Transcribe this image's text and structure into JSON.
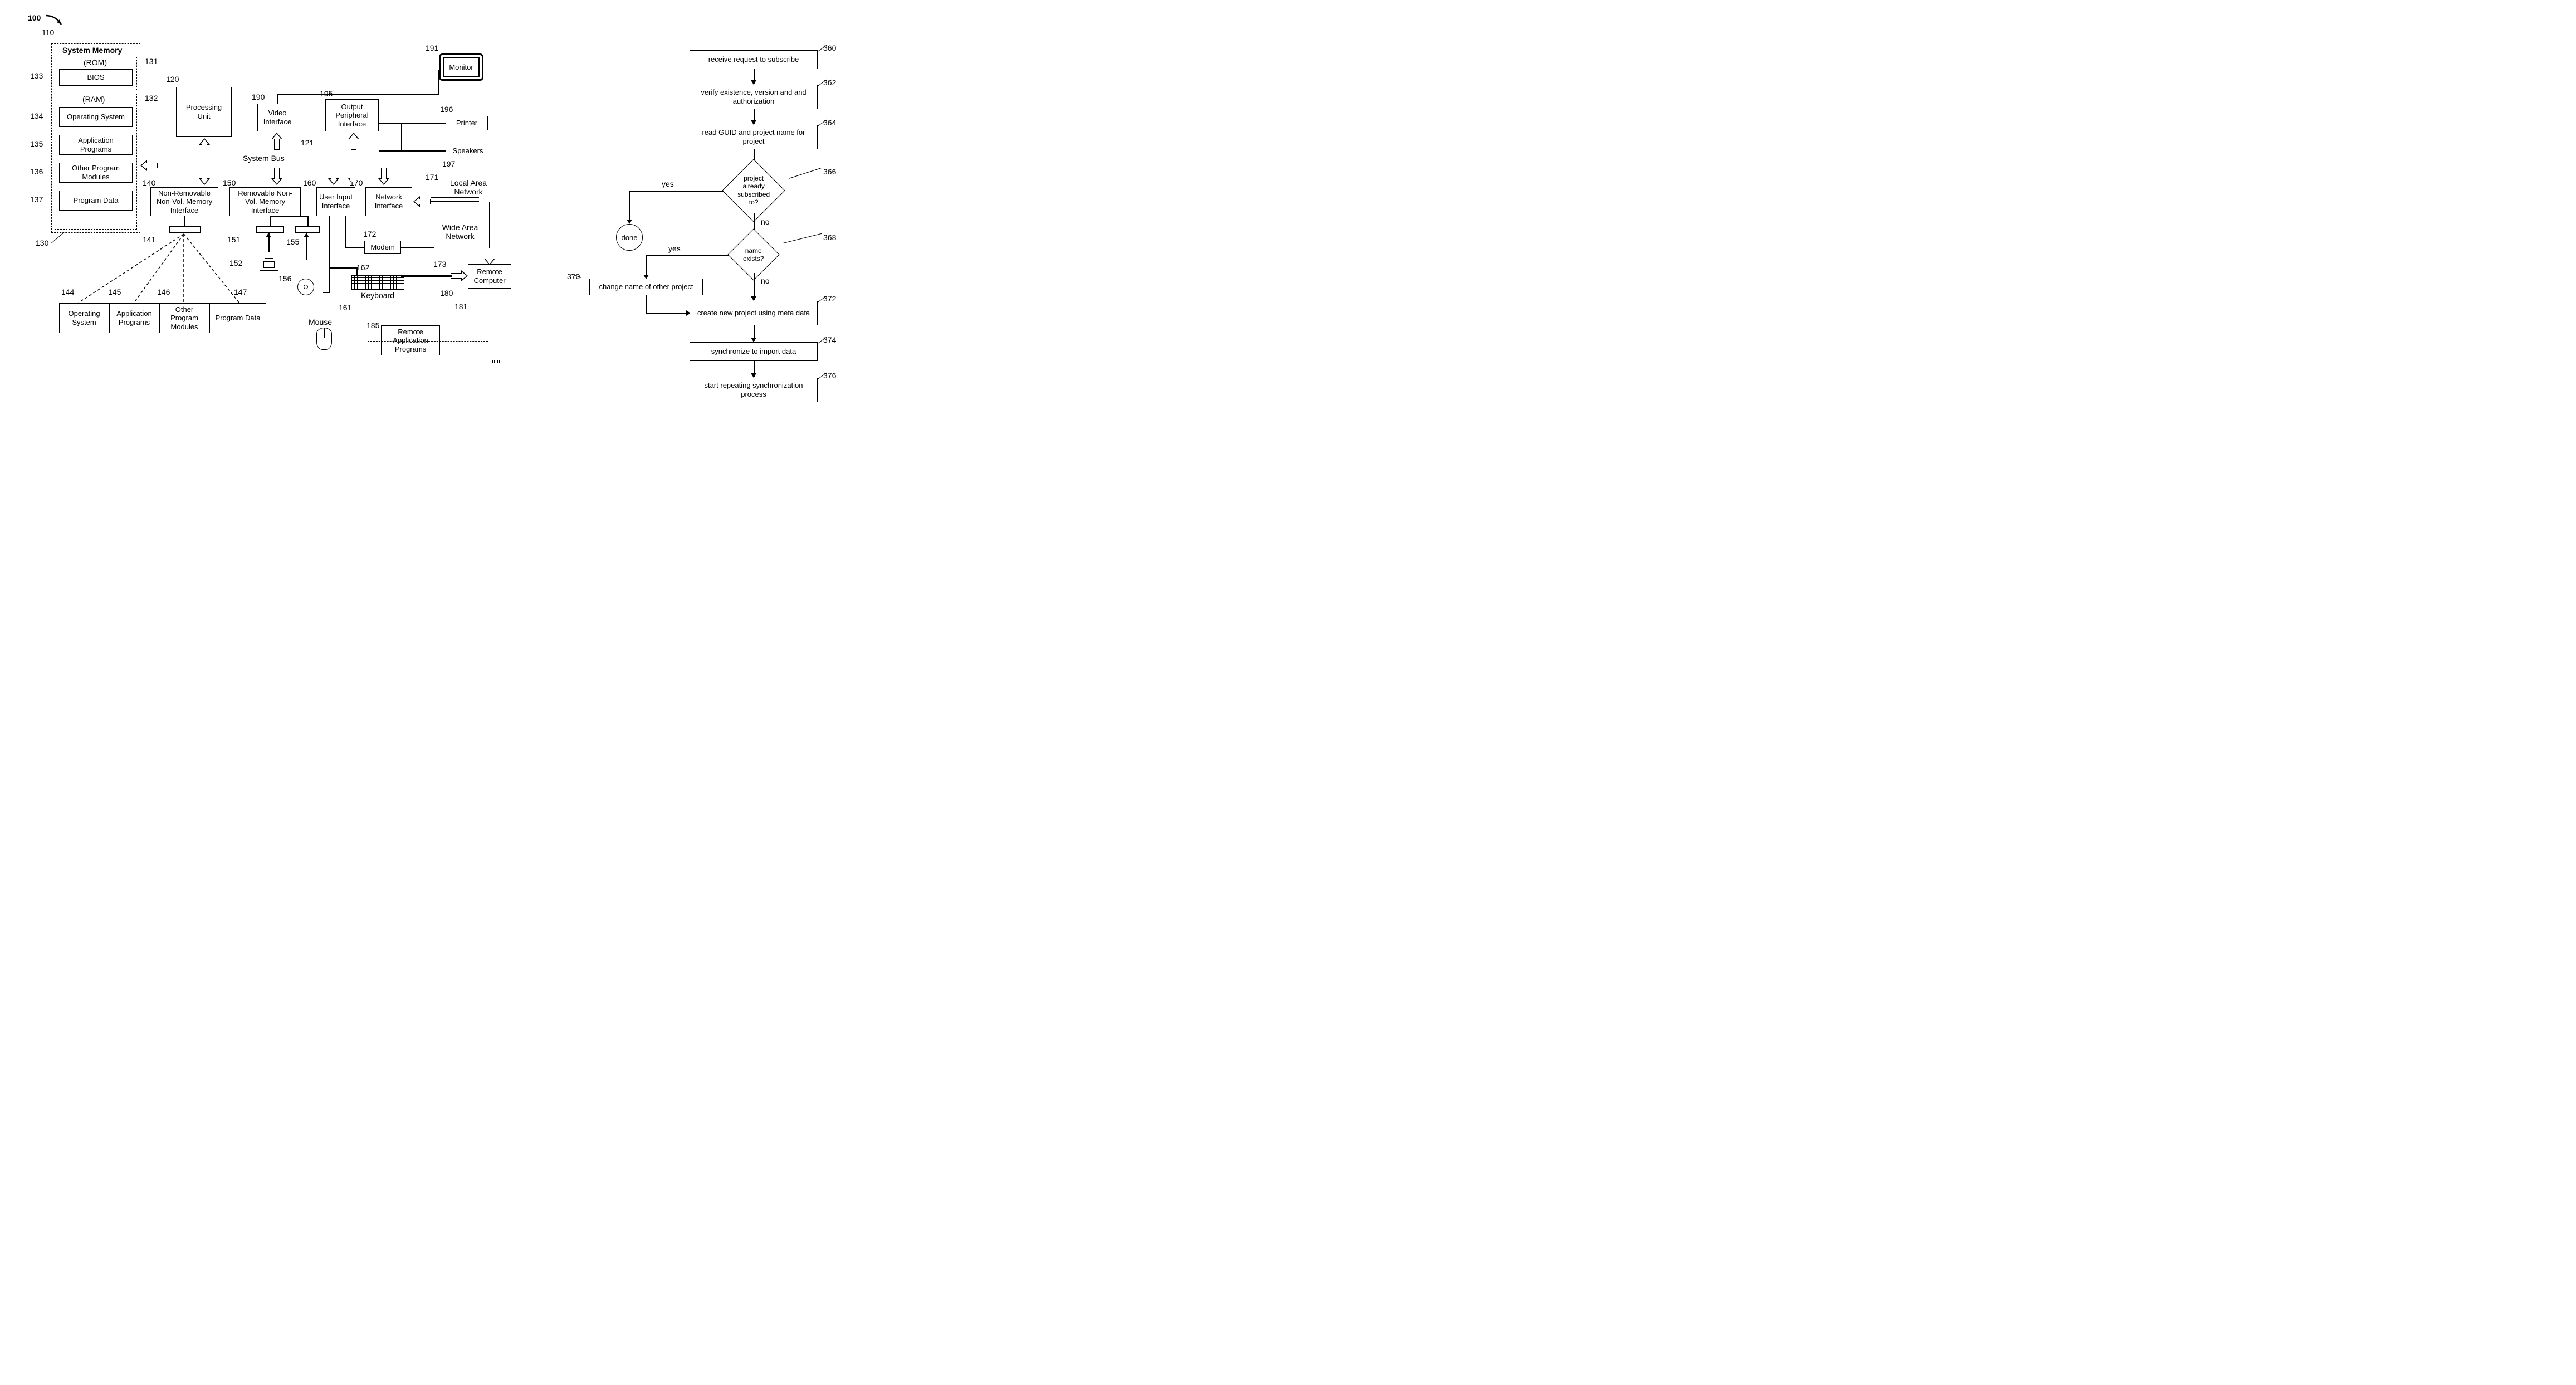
{
  "fig1": {
    "ref_100": "100",
    "ref_110": "110",
    "sysmem_title": "System Memory",
    "rom_title": "(ROM)",
    "bios": "BIOS",
    "ref_131": "131",
    "ref_133": "133",
    "ram_title": "(RAM)",
    "ref_132": "132",
    "os": "Operating System",
    "ref_134": "134",
    "apps": "Application Programs",
    "ref_135": "135",
    "modules": "Other Program Modules",
    "ref_136": "136",
    "pdata": "Program Data",
    "ref_137": "137",
    "ref_130": "130",
    "processing_unit": "Processing Unit",
    "ref_120": "120",
    "video_if": "Video Interface",
    "ref_190": "190",
    "output_if": "Output Peripheral Interface",
    "ref_195": "195",
    "system_bus": "System Bus",
    "ref_121": "121",
    "nonrem_if": "Non-Removable Non-Vol. Memory Interface",
    "ref_140": "140",
    "rem_if": "Removable Non-Vol. Memory Interface",
    "ref_150": "150",
    "user_if": "User Input Interface",
    "ref_160": "160",
    "net_if": "Network Interface",
    "ref_170": "170",
    "ref_141": "141",
    "ref_151": "151",
    "ref_155": "155",
    "ref_152": "152",
    "ref_156": "156",
    "modem": "Modem",
    "ref_172": "172",
    "keyboard": "Keyboard",
    "ref_162": "162",
    "mouse": "Mouse",
    "ref_161": "161",
    "disk_os": "Operating System",
    "ref_144": "144",
    "disk_apps": "Application Programs",
    "ref_145": "145",
    "disk_modules": "Other Program Modules",
    "ref_146": "146",
    "disk_pdata": "Program Data",
    "ref_147": "147",
    "monitor": "Monitor",
    "ref_191": "191",
    "printer": "Printer",
    "ref_196": "196",
    "speakers": "Speakers",
    "ref_197": "197",
    "lan": "Local Area Network",
    "ref_171": "171",
    "wan": "Wide Area Network",
    "ref_173": "173",
    "remote_computer": "Remote Computer",
    "ref_180": "180",
    "ref_181": "181",
    "remote_apps": "Remote Application Programs",
    "ref_185": "185"
  },
  "fig2": {
    "step360": "receive request to subscribe",
    "ref_360": "360",
    "step362": "verify existence, version and and authorization",
    "ref_362": "362",
    "step364": "read GUID and project name for project",
    "ref_364": "364",
    "dec366": "project already subscribed to?",
    "ref_366": "366",
    "done": "done",
    "yes1": "yes",
    "no1": "no",
    "dec368": "name exists?",
    "ref_368": "368",
    "yes2": "yes",
    "no2": "no",
    "step370": "change name of other project",
    "ref_370": "370",
    "step372": "create new project using meta data",
    "ref_372": "372",
    "step374": "synchronize to import data",
    "ref_374": "374",
    "step376": "start repeating synchronization process",
    "ref_376": "376"
  }
}
